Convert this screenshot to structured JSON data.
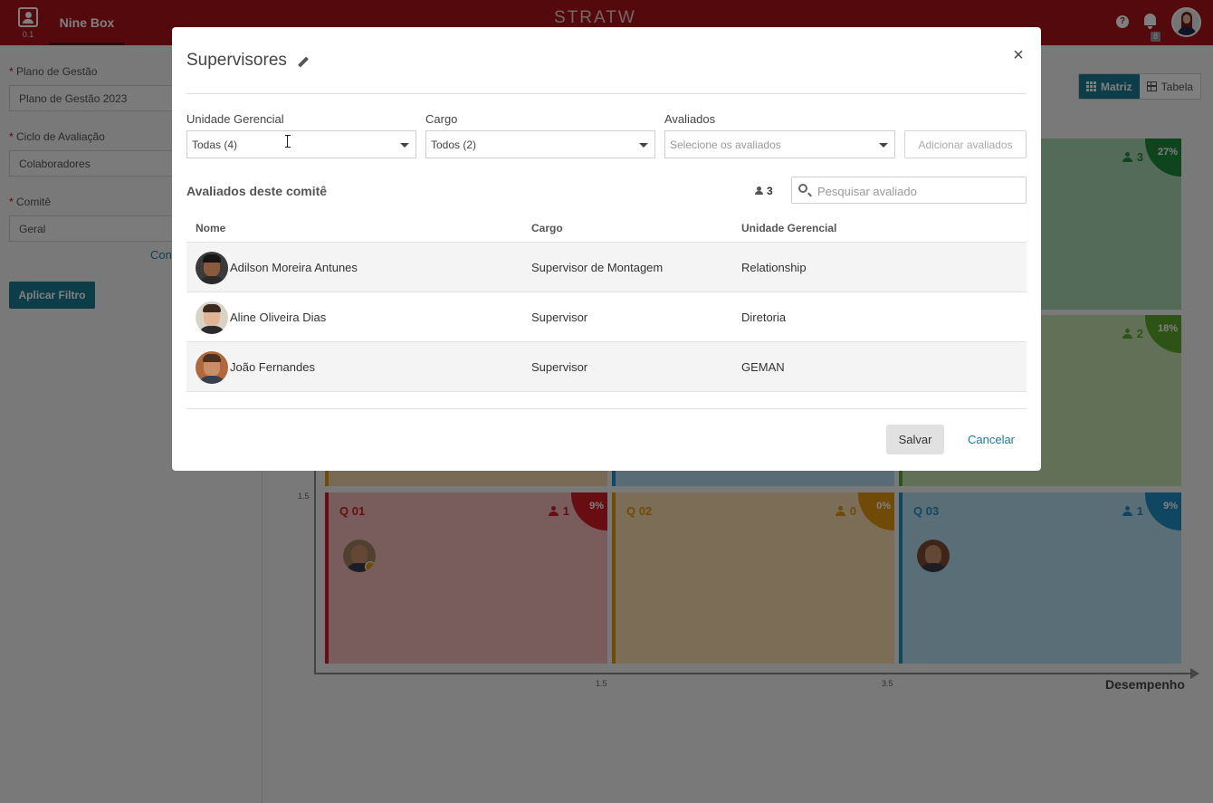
{
  "topbar": {
    "app_version": "0.1",
    "title": "Nine Box",
    "logo_text": "STRATW",
    "help_glyph": "?",
    "notifications_count": "8",
    "color": "#a8151b"
  },
  "sidebar": {
    "plano_label": "Plano de Gestão",
    "plano_value": "Plano de Gestão 2023",
    "ciclo_label": "Ciclo de Avaliação",
    "ciclo_value": "Colaboradores",
    "comite_label": "Comitê",
    "comite_value": "Geral",
    "link_partial": "Con",
    "apply_button": "Aplicar Filtro"
  },
  "view_toggle": {
    "matrix_label": "Matriz",
    "table_label": "Tabela",
    "active": "Matriz"
  },
  "ninebox": {
    "y_tick": "1.5",
    "x_ticks": [
      "1.5",
      "3.5"
    ],
    "x_axis_label": "Desempenho",
    "boxes": [
      {
        "title": "",
        "count": "3",
        "percent": "27%",
        "color": "#1e8a3c"
      },
      {
        "title": "",
        "count": "2",
        "percent": "18%",
        "color": "#5aa62e"
      },
      {
        "title": "Q 01",
        "count": "1",
        "percent": "9%",
        "color": "#d01c26"
      },
      {
        "title": "Q 02",
        "count": "0",
        "percent": "0%",
        "color": "#e0960e"
      },
      {
        "title": "Q 03",
        "count": "1",
        "percent": "9%",
        "color": "#1f8fc4"
      }
    ]
  },
  "modal": {
    "title": "Supervisores",
    "close_glyph": "×",
    "unidade_label": "Unidade Gerencial",
    "unidade_value": "Todas (4)",
    "cargo_label": "Cargo",
    "cargo_value": "Todos (2)",
    "avaliados_label": "Avaliados",
    "avaliados_placeholder": "Selecione os avaliados",
    "add_button": "Adicionar avaliados",
    "section_title": "Avaliados deste comitê",
    "count": "3",
    "search_placeholder": "Pesquisar avaliado",
    "columns": [
      "Nome",
      "Cargo",
      "Unidade Gerencial"
    ],
    "rows": [
      {
        "name": "Adilson Moreira Antunes",
        "cargo": "Supervisor de Montagem",
        "unidade": "Relationship"
      },
      {
        "name": "Aline Oliveira Dias",
        "cargo": "Supervisor",
        "unidade": "Diretoria"
      },
      {
        "name": "João Fernandes",
        "cargo": "Supervisor",
        "unidade": "GEMAN"
      }
    ],
    "save_button": "Salvar",
    "cancel_button": "Cancelar"
  }
}
